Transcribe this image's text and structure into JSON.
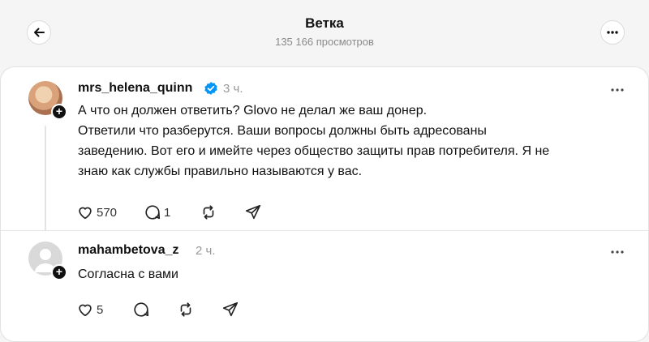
{
  "header": {
    "title": "Ветка",
    "views": "135 166 просмотров",
    "back_icon": "arrow-left-icon",
    "more_icon": "more-horizontal-icon"
  },
  "posts": [
    {
      "username": "mrs_helena_quinn",
      "verified": true,
      "time": "3 ч.",
      "lines": [
        "А что он должен ответить? Glovo не делал же ваш донер.",
        "Ответили что разберутся. Ваши вопросы должны быть адресованы",
        "заведению. Вот его и имейте через общество защиты прав потребителя. Я не",
        "знаю как службы правильно называются у вас."
      ],
      "likes": "570",
      "replies": "1"
    },
    {
      "username": "mahambetova_z",
      "verified": false,
      "time": "2 ч.",
      "lines": [
        "Согласна с вами"
      ],
      "likes": "5",
      "replies": ""
    }
  ],
  "badge": "+",
  "colors": {
    "background": "#f5f5f5",
    "card": "#ffffff",
    "verified": "#0095f6",
    "muted": "#999999"
  }
}
